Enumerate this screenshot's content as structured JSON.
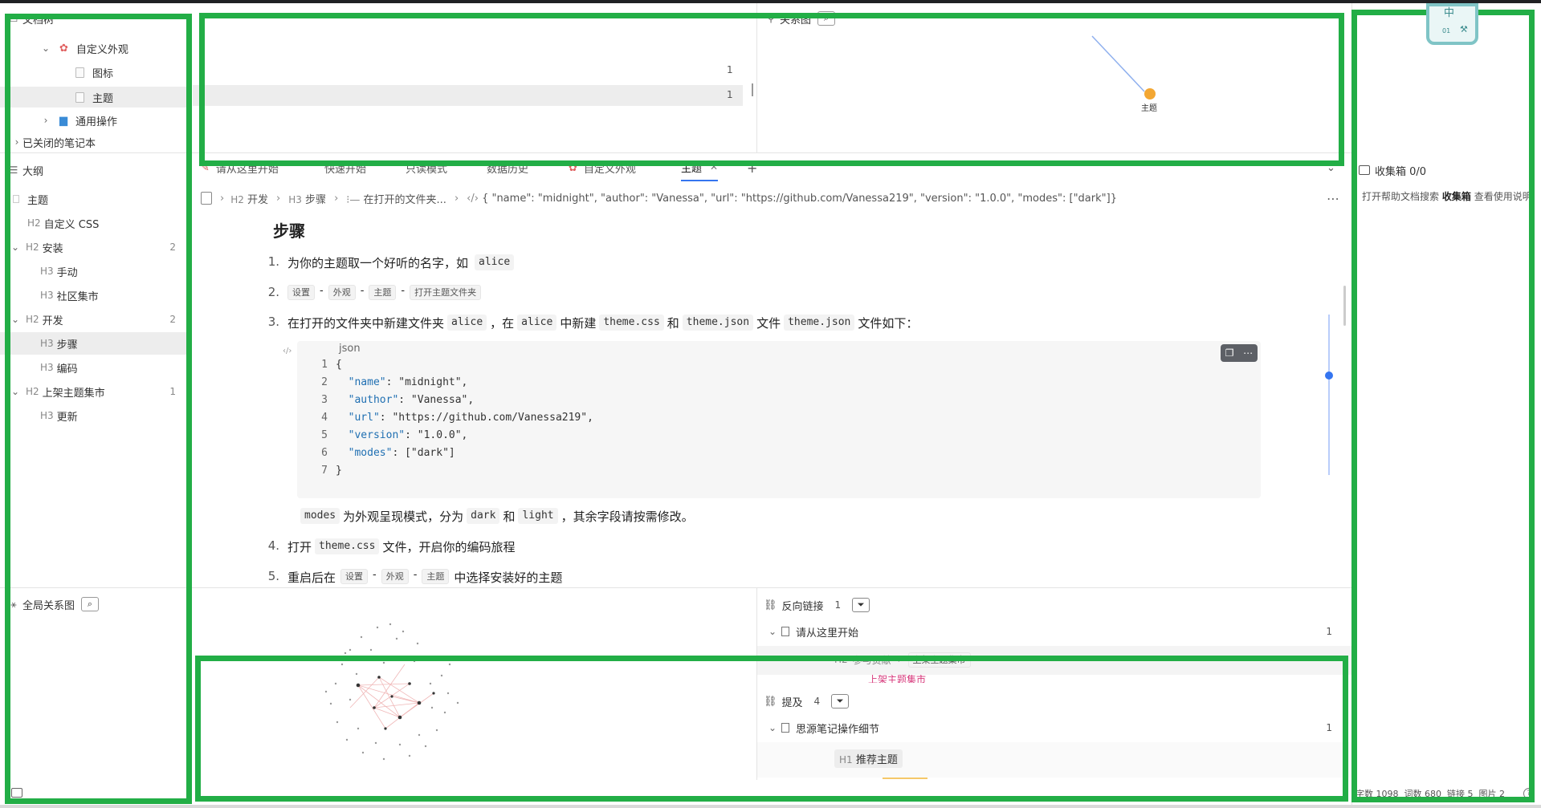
{
  "colors": {
    "highlight": "#22ae46",
    "accent": "#3575f0",
    "node_orange": "#f3a733",
    "tab_active": "#3575f0"
  },
  "doc_tree": {
    "title": "文档树",
    "items": [
      {
        "label": "自定义外观",
        "icon": "palette-icon",
        "count": ""
      },
      {
        "label": "图标",
        "icon": "doc-icon",
        "count": ""
      },
      {
        "label": "主题",
        "icon": "doc-icon",
        "count": ""
      },
      {
        "label": "通用操作",
        "icon": "bus-icon",
        "count": ""
      },
      {
        "label": "已关闭的笔记本",
        "icon": "chevron-right-icon",
        "count": ""
      }
    ]
  },
  "backlink_top": {
    "counts": [
      "1",
      "1"
    ]
  },
  "graph": {
    "title": "关系图",
    "node_label": "主题"
  },
  "float_widget": {
    "ime_label": "中",
    "sub_label": "01"
  },
  "outline": {
    "title": "大纲",
    "items": [
      {
        "label": "主题",
        "level": "",
        "count": ""
      },
      {
        "label": "自定义 CSS",
        "level": "H2",
        "count": ""
      },
      {
        "label": "安装",
        "level": "H2",
        "count": "2"
      },
      {
        "label": "手动",
        "level": "H3",
        "count": ""
      },
      {
        "label": "社区集市",
        "level": "H3",
        "count": ""
      },
      {
        "label": "开发",
        "level": "H2",
        "count": "2"
      },
      {
        "label": "步骤",
        "level": "H3",
        "count": ""
      },
      {
        "label": "编码",
        "level": "H3",
        "count": ""
      },
      {
        "label": "上架主题集市",
        "level": "H2",
        "count": "1"
      },
      {
        "label": "更新",
        "level": "H3",
        "count": ""
      }
    ]
  },
  "global_graph": {
    "title": "全局关系图"
  },
  "tabs": [
    {
      "label": "请从这里开始"
    },
    {
      "label": "快速开始"
    },
    {
      "label": "只读模式"
    },
    {
      "label": "数据历史"
    },
    {
      "label": "自定义外观"
    },
    {
      "label": "主题"
    }
  ],
  "tab_add": "+",
  "breadcrumb": {
    "items": [
      "开发",
      "步骤",
      "在打开的文件夹...",
      "{ \"name\": \"midnight\", \"author\": \"Vanessa\", \"url\": \"https://github.com/Vanessa219\", \"version\": \"1.0.0\", \"modes\": [\"dark\"]}"
    ],
    "levels": [
      "H2",
      "H3",
      "",
      ""
    ]
  },
  "editor": {
    "heading": "步骤",
    "step1": {
      "num": "1.",
      "text": "为你的主题取一个好听的名字，如",
      "code": "alice"
    },
    "step2": {
      "num": "2.",
      "pills": [
        "设置",
        "外观",
        "主题",
        "打开主题文件夹"
      ],
      "dash": "-"
    },
    "step3": {
      "num": "3.",
      "text_a": "在打开的文件夹中新建文件夹",
      "code_a": "alice",
      "text_b": "，在",
      "code_b": "alice",
      "text_c": "中新建",
      "code_c": "theme.css",
      "text_d": "和",
      "code_d": "theme.json",
      "text_e": "文件",
      "code_e": "theme.json",
      "text_f": "文件如下："
    },
    "codeblock": {
      "lang": "json",
      "lines": [
        {
          "n": "1",
          "text": "{"
        },
        {
          "n": "2",
          "key": "\"name\"",
          "val": ": \"midnight\","
        },
        {
          "n": "3",
          "key": "\"author\"",
          "val": ": \"Vanessa\","
        },
        {
          "n": "4",
          "key": "\"url\"",
          "val": ": \"https://github.com/Vanessa219\","
        },
        {
          "n": "5",
          "key": "\"version\"",
          "val": ": \"1.0.0\","
        },
        {
          "n": "6",
          "key": "\"modes\"",
          "val": ": [\"dark\"]"
        },
        {
          "n": "7",
          "text": "}"
        }
      ]
    },
    "note": {
      "code_a": "modes",
      "text_a": "为外观呈现模式，分为",
      "code_b": "dark",
      "text_b": "和",
      "code_c": "light",
      "text_c": "，其余字段请按需修改。"
    },
    "step4": {
      "num": "4.",
      "text_a": "打开",
      "code": "theme.css",
      "text_b": "文件，开启你的编码旅程"
    },
    "step5": {
      "num": "5.",
      "text_a": "重启后在",
      "pills": [
        "设置",
        "外观",
        "主题"
      ],
      "dash": "-",
      "text_b": "中选择安装好的主题"
    }
  },
  "inbox": {
    "title": "收集箱 0/0",
    "help_a": "打开帮助文档搜索",
    "help_strong": "收集箱",
    "help_b": "查看使用说明"
  },
  "backlinks": {
    "title": "反向链接",
    "count": "1",
    "doc": "请从这里开始",
    "doc_count": "1",
    "sub_level": "H2",
    "sub_a": "参与贡献",
    "sub_b": "上架主题集市",
    "sub_red": "上架主题集市"
  },
  "mentions": {
    "title": "提及",
    "count": "4",
    "doc": "思源笔记操作细节",
    "doc_count": "1",
    "heading_level": "H1",
    "heading": "推荐主题"
  },
  "statusbar": {
    "text": "字数 1098  词数 680  链接 5  图片 2",
    "help": "?"
  }
}
